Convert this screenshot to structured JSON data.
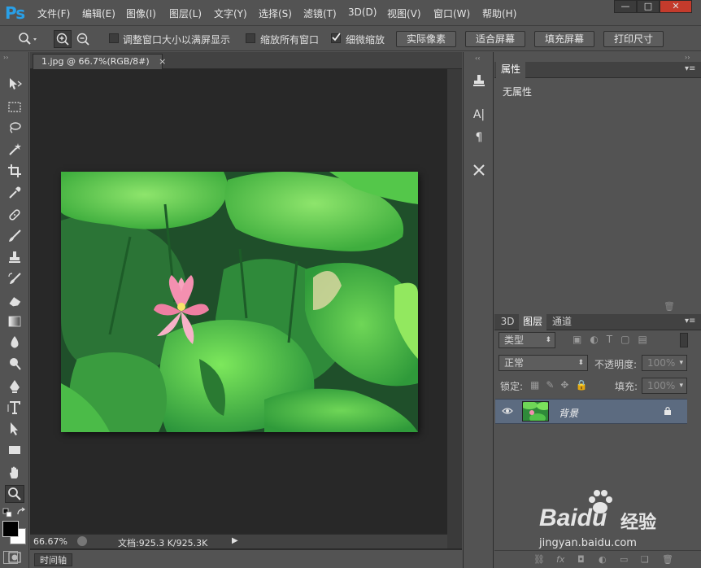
{
  "app": {
    "logo": "Ps"
  },
  "menu": [
    "文件(F)",
    "编辑(E)",
    "图像(I)",
    "图层(L)",
    "文字(Y)",
    "选择(S)",
    "滤镜(T)",
    "3D(D)",
    "视图(V)",
    "窗口(W)",
    "帮助(H)"
  ],
  "window_controls": {
    "minimize": "—",
    "maximize": "□",
    "close": "✕"
  },
  "options": {
    "resize_windows_label": "调整窗口大小以满屏显示",
    "resize_windows_checked": false,
    "zoom_all_label": "缩放所有窗口",
    "zoom_all_checked": false,
    "scrubby_zoom_label": "细微缩放",
    "scrubby_zoom_checked": true,
    "actual_pixels": "实际像素",
    "fit_screen": "适合屏幕",
    "fill_screen": "填充屏幕",
    "print_size": "打印尺寸"
  },
  "document": {
    "tab_title": "1.jpg @ 66.7%(RGB/8#)",
    "tab_close": "×",
    "zoom": "66.67%",
    "doc_info": "文档:925.3 K/925.3K"
  },
  "timeline": {
    "label": "时间轴"
  },
  "properties": {
    "tab": "属性",
    "empty": "无属性"
  },
  "layers": {
    "tabs": [
      "3D",
      "图层",
      "通道"
    ],
    "active_tab": "图层",
    "filter_kind": "类型",
    "blend_mode": "正常",
    "opacity_label": "不透明度:",
    "opacity_value": "100%",
    "lock_label": "锁定:",
    "fill_label": "填充:",
    "fill_value": "100%",
    "items": [
      {
        "name": "背景",
        "visible": true,
        "locked": true
      }
    ]
  },
  "watermark": {
    "brand": "Baidu",
    "brand_cn": "经验",
    "url": "jingyan.baidu.com"
  },
  "colors": {
    "accent": "#29a0e8",
    "selected_layer": "#5c6b80",
    "panel": "#535353",
    "canvas_bg": "#282828"
  }
}
